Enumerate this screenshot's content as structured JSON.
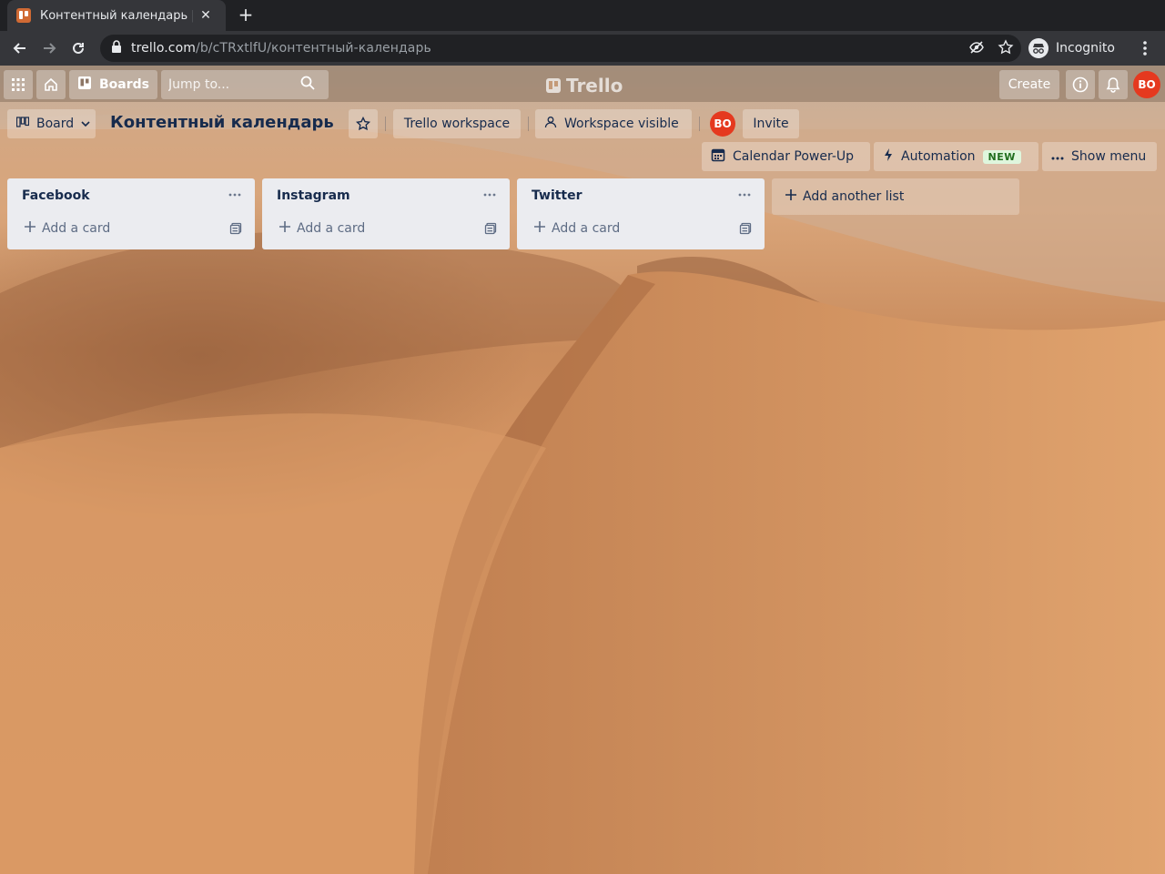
{
  "browser": {
    "tab_title": "Контентный календарь | Trello",
    "url_host": "trello.com",
    "url_path": "/b/cTRxtlfU/контентный-календарь",
    "incognito_label": "Incognito"
  },
  "header": {
    "boards_label": "Boards",
    "search_placeholder": "Jump to...",
    "logo_text": "Trello",
    "create_label": "Create",
    "avatar_initials": "BO"
  },
  "board": {
    "view_label": "Board",
    "title": "Контентный календарь",
    "workspace_label": "Trello workspace",
    "visibility_label": "Workspace visible",
    "member_initials": "BO",
    "invite_label": "Invite",
    "calendar_label": "Calendar Power-Up",
    "automation_label": "Automation",
    "automation_badge": "NEW",
    "show_menu_label": "Show menu"
  },
  "lists": [
    {
      "title": "Facebook",
      "add_card_label": "Add a card"
    },
    {
      "title": "Instagram",
      "add_card_label": "Add a card"
    },
    {
      "title": "Twitter",
      "add_card_label": "Add a card"
    }
  ],
  "add_list_label": "Add another list",
  "colors": {
    "accent_red": "#e5391f",
    "list_bg": "#ebecf0",
    "new_badge_bg": "#dff6dd"
  }
}
